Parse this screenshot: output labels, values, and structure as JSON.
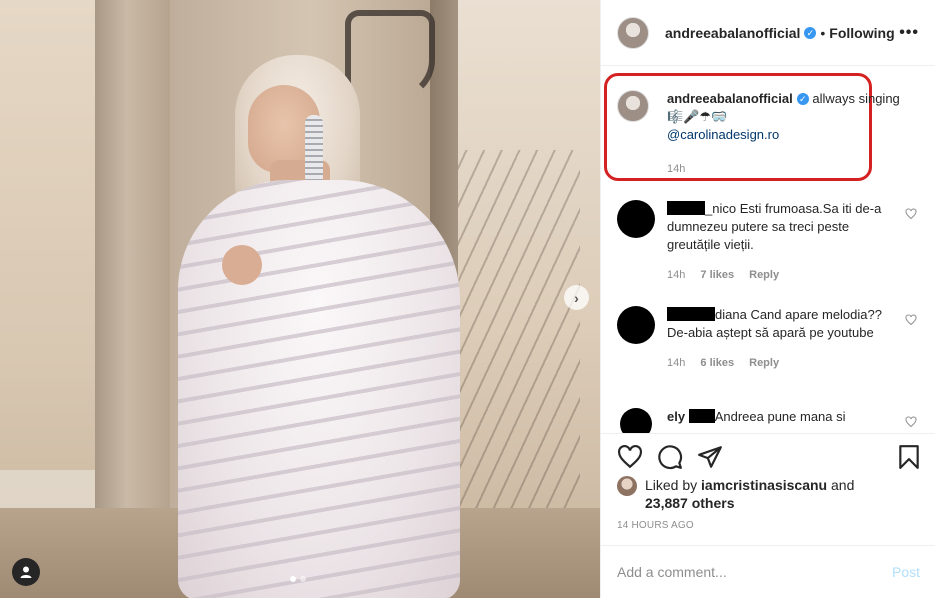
{
  "header": {
    "username": "andreeabalanofficial",
    "separator": "•",
    "follow_status": "Following",
    "more": "•••"
  },
  "caption": {
    "username": "andreeabalanofficial",
    "text": "allways singing 🎼🎤☂🥽",
    "mention": "@carolinadesign.ro",
    "time": "14h"
  },
  "comments": [
    {
      "username_suffix": "_nico",
      "text": "Esti frumoasa.Sa iti de-a dumnezeu putere sa treci peste greutățile vieții.",
      "time": "14h",
      "likes": "7 likes",
      "reply": "Reply"
    },
    {
      "username_suffix": "diana",
      "text": "Cand apare melodia??De-abia aștept să apară pe youtube",
      "time": "14h",
      "likes": "6 likes",
      "reply": "Reply"
    },
    {
      "username_prefix": "ely",
      "text": "Andreea pune mana si"
    }
  ],
  "likes": {
    "prefix": "Liked by",
    "user": "iamcristinasiscanu",
    "and": "and",
    "others": "23,887 others"
  },
  "posted": "14 HOURS AGO",
  "add_comment": {
    "placeholder": "Add a comment...",
    "post_label": "Post"
  },
  "colors": {
    "highlight": "#d42121",
    "link": "#00376b",
    "verified": "#3897f0",
    "muted": "#8e8e8e"
  },
  "icons": [
    "heart-icon",
    "comment-icon",
    "share-icon",
    "bookmark-icon",
    "user-tag-icon",
    "chevron-right-icon",
    "verified-icon"
  ]
}
